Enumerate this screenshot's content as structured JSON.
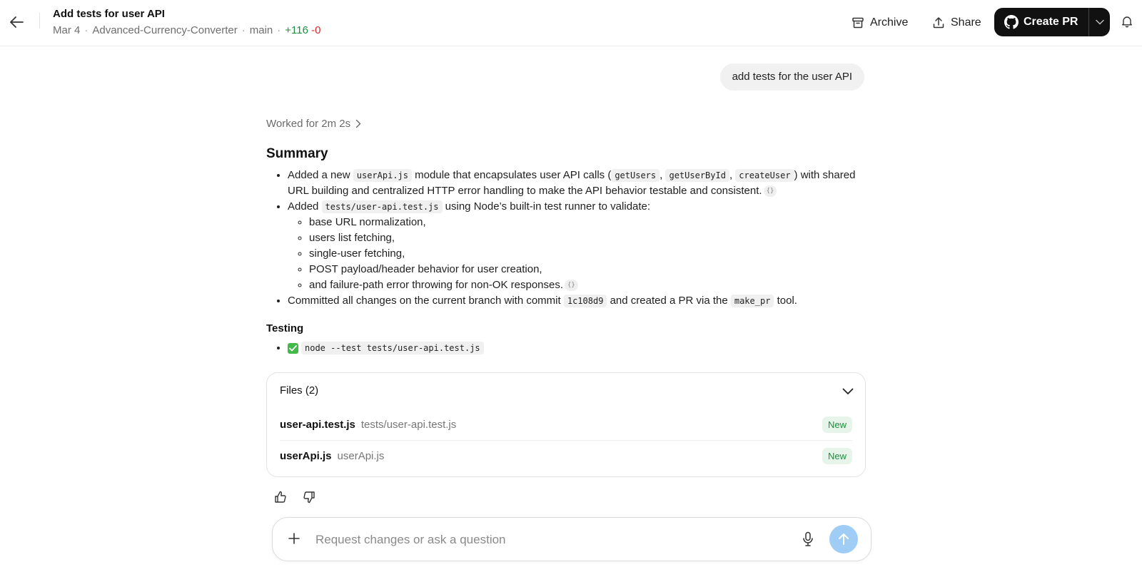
{
  "header": {
    "title": "Add tests for user API",
    "date": "Mar 4",
    "repo": "Advanced-Currency-Converter",
    "branch": "main",
    "additions": "+116",
    "deletions": "-0",
    "archive_label": "Archive",
    "share_label": "Share",
    "create_pr_label": "Create PR"
  },
  "conversation": {
    "user_message": "add tests for the user API",
    "worked_for": "Worked for 2m 2s"
  },
  "summary": {
    "heading": "Summary",
    "item1": {
      "t1": "Added a new ",
      "code1": "userApi.js",
      "t2": " module that encapsulates user API calls (",
      "code2": "getUsers",
      "t3": ", ",
      "code3": "getUserById",
      "t4": ", ",
      "code4": "createUser",
      "t5": ") with shared URL building and centralized HTTP error handling to make the API behavior testable and consistent."
    },
    "item2": {
      "t1": "Added ",
      "code1": "tests/user-api.test.js",
      "t2": " using Node’s built-in test runner to validate:",
      "sub": [
        "base URL normalization,",
        "users list fetching,",
        "single-user fetching,",
        "POST payload/header behavior for user creation,",
        "and failure-path error throwing for non-OK responses."
      ]
    },
    "item3": {
      "t1": "Committed all changes on the current branch with commit ",
      "code1": "1c108d9",
      "t2": " and created a PR via the ",
      "code2": "make_pr",
      "t3": " tool."
    },
    "citation_glyph": "{}"
  },
  "testing": {
    "heading": "Testing",
    "command": "node --test tests/user-api.test.js",
    "status": "pass"
  },
  "files": {
    "header": "Files (2)",
    "items": [
      {
        "name": "user-api.test.js",
        "path": "tests/user-api.test.js",
        "badge": "New"
      },
      {
        "name": "userApi.js",
        "path": "userApi.js",
        "badge": "New"
      }
    ]
  },
  "composer": {
    "placeholder": "Request changes or ask a question"
  },
  "colors": {
    "additions": "#1a8f3c",
    "deletions": "#d92b2b",
    "new_badge_bg": "#e6f4ea",
    "new_badge_text": "#1e8e3e",
    "send_button": "#9fcdf6",
    "create_pr_bg": "#111111"
  },
  "icons": [
    "back-arrow-icon",
    "archive-icon",
    "share-icon",
    "github-icon",
    "chevron-down-icon",
    "bell-icon",
    "chevron-right-icon",
    "check-icon",
    "thumbs-up-icon",
    "thumbs-down-icon",
    "plus-icon",
    "microphone-icon",
    "arrow-up-icon"
  ]
}
